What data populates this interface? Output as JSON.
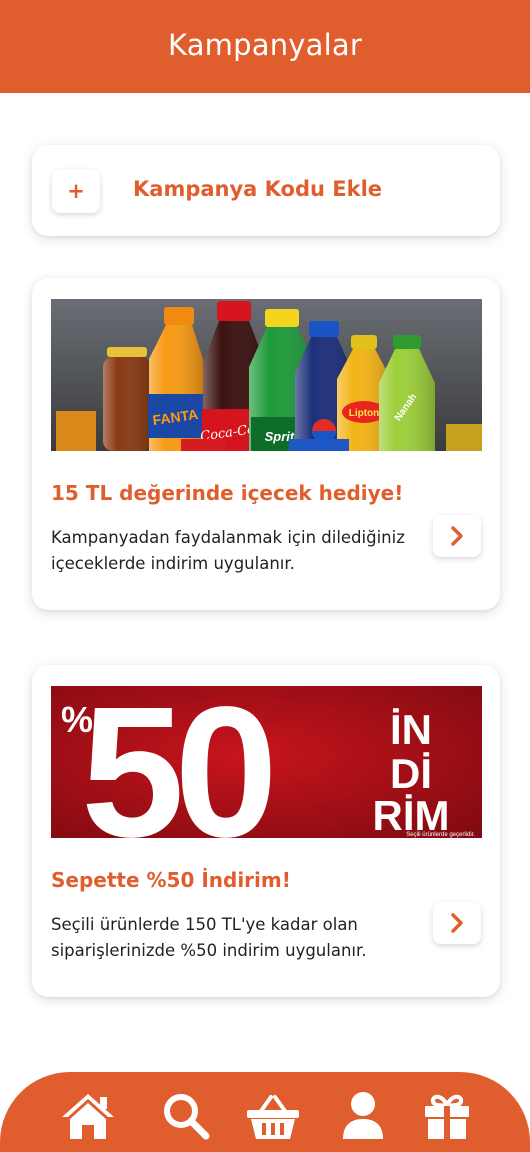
{
  "header": {
    "title": "Kampanyalar"
  },
  "promo": {
    "plus": "+",
    "label": "Kampanya Kodu Ekle"
  },
  "campaigns": [
    {
      "title": "15 TL değerinde içecek hediye!",
      "description": "Kampanyadan faydalanmak için dilediğiniz içeceklerde indirim uygulanır.",
      "banner": {
        "bottle_labels": [
          "FANTA",
          "Coca-Cola",
          "Sprite",
          "Lipton",
          "Nanah"
        ]
      }
    },
    {
      "title": "Sepette %50 İndirim!",
      "description": "Seçili ürünlerde 150 TL'ye kadar olan siparişlerinizde %50 indirim uygulanır.",
      "banner": {
        "percent": "%",
        "big_number": "50",
        "word_line1": "İN",
        "word_line2": "Dİ",
        "word_line3": "RİM",
        "fine_print": "Seçili ürünlerde geçerlidir."
      }
    }
  ],
  "bottom_nav": {
    "items": [
      {
        "icon": "home-icon"
      },
      {
        "icon": "search-icon"
      },
      {
        "icon": "basket-icon"
      },
      {
        "icon": "user-icon"
      },
      {
        "icon": "gift-icon"
      }
    ]
  },
  "colors": {
    "accent": "#e05e2d",
    "banner_red": "#b0141c",
    "text": "#222222",
    "background": "#ffffff"
  }
}
